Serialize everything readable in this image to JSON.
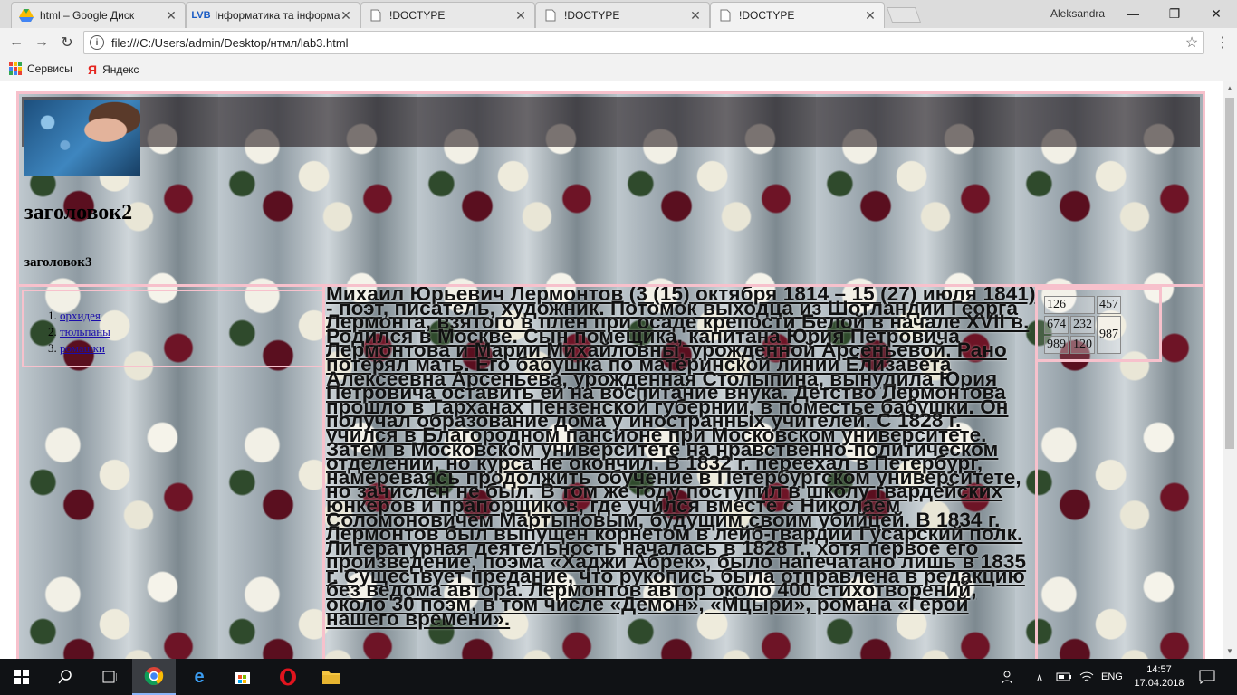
{
  "browser": {
    "tabs": [
      {
        "title": "html – Google Диск",
        "favicon": "google-drive-icon",
        "active": false
      },
      {
        "title": "Інформатика та інформат",
        "favicon": "lvb-icon",
        "active": false
      },
      {
        "title": "!DOCTYPE",
        "favicon": "document-icon",
        "active": false
      },
      {
        "title": "!DOCTYPE",
        "favicon": "document-icon",
        "active": false
      },
      {
        "title": "!DOCTYPE",
        "favicon": "document-icon",
        "active": true
      }
    ],
    "profile_name": "Aleksandra",
    "url": "file:///C:/Users/admin/Desktop/нтмл/lab3.html",
    "bookmarks": [
      {
        "label": "Сервисы",
        "icon": "apps-icon"
      },
      {
        "label": "Яндекс",
        "icon": "yandex-icon"
      }
    ]
  },
  "page": {
    "heading2": "заголовок2",
    "heading3": "заголовок3",
    "nav_items": [
      "орхидея",
      "тюльпаны",
      "ромашки"
    ],
    "article_text": "Михаил Юрьевич Лермонтов (3 (15) октября 1814 – 15 (27) июля 1841) - поэт, писатель, художник. Потомок выходца из Шотландии Георга Лермонта, взятого в плен при осаде крепости Белой в начале XVII в. Родился в Москве. Сын помещика, капитана Юрия Петровича Лермонтова и Марии Михайловны, урожденной Арсеньевой. Рано потерял мать. Его бабушка по материнской линии Елизавета Алексеевна Арсеньева, урожденная Столыпина, вынудила Юрия Петровича оставить ей на воспитание внука. Детство Лермонтова прошло в Тарханах Пензенской губернии, в поместье бабушки. Он получал образование дома у иностранных учителей. С 1828 г. учился в Благородном пансионе при Московском университете. Затем в Московском университете на нравственно-политическом отделении, но курса не окончил. В 1832 г. переехал в Петербург, намереваясь продолжить обучение в Петербургском университете, но зачислен не был. В том же году поступил в школу гвардейских юнкеров и прапорщиков, где учился вместе с Николаем Соломоновичем Мартыновым, будущим своим убийцей. В 1834 г. Лермонтов был выпущен корнетом в лейб-гвардии Гусарский полк. Литературная деятельность началась в 1828 г., хотя первое его произведение, поэма «Хаджи Абрек», было напечатано лишь в 1835 г. Существует предание, что рукопись была отправлена в редакцию без ведома автора. Лермонтов автор около 400 стихотворений, около 30 поэм, в том числе «Демон», «Мцыри», романа «Герой нашего времени».",
    "table": [
      [
        "126",
        "",
        "457"
      ],
      [
        "674",
        "232",
        "987"
      ],
      [
        "989",
        "120",
        ""
      ]
    ]
  },
  "taskbar": {
    "language": "ENG",
    "time": "14:57",
    "date": "17.04.2018"
  }
}
